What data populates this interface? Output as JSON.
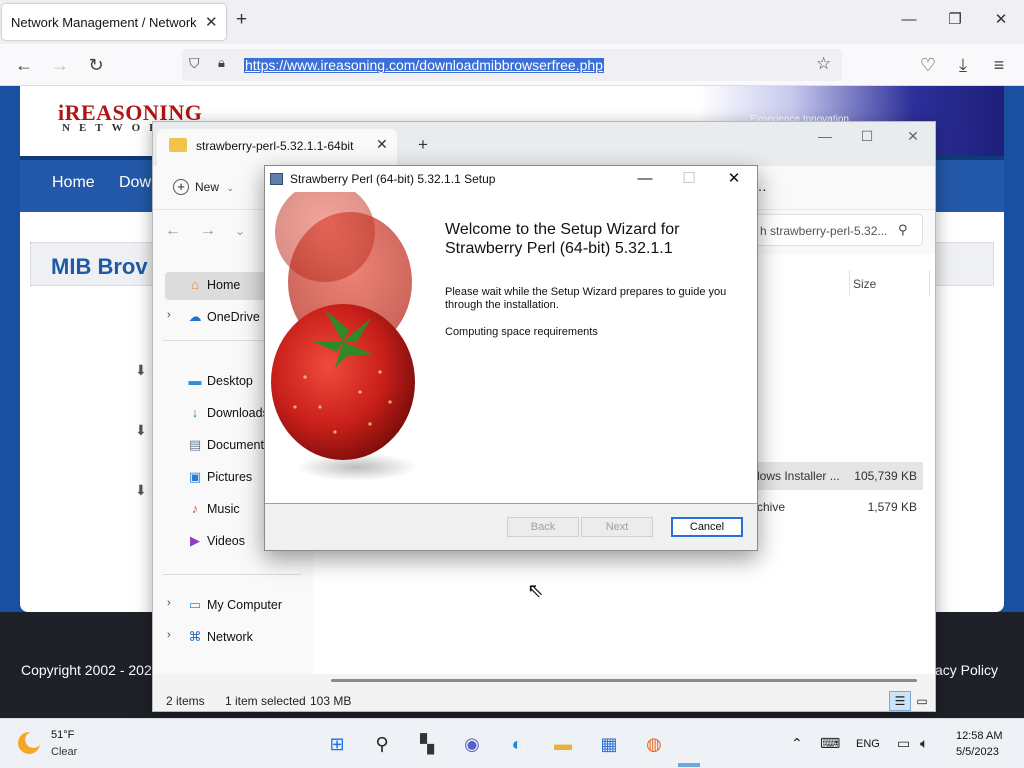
{
  "browser": {
    "tab_title": "Network Management / Network M",
    "url": "https://www.ireasoning.com/downloadmibbrowserfree.php"
  },
  "website": {
    "logo": "iREASONING",
    "logo_sub": "NETWOR",
    "banner_text": "Experience Innovation",
    "menu": [
      "Home",
      "Dow"
    ],
    "page_title": "MIB Brov",
    "copyright": "Copyright 2002 - 202",
    "privacy": "vacy Policy"
  },
  "explorer": {
    "tab_label": "strawberry-perl-5.32.1.1-64bit",
    "new_label": "New",
    "search_placeholder": "h strawberry-perl-5.32...",
    "column_size": "Size",
    "sidebar": [
      {
        "label": "Home",
        "icon": "home-icon"
      },
      {
        "label": "OneDrive",
        "icon": "cloud-icon"
      },
      {
        "label": "Desktop",
        "icon": "desktop-icon"
      },
      {
        "label": "Downloads",
        "icon": "download-icon"
      },
      {
        "label": "Documents",
        "icon": "document-icon"
      },
      {
        "label": "Pictures",
        "icon": "pictures-icon"
      },
      {
        "label": "Music",
        "icon": "music-icon"
      },
      {
        "label": "Videos",
        "icon": "videos-icon"
      },
      {
        "label": "My Computer",
        "icon": "computer-icon"
      },
      {
        "label": "Network",
        "icon": "network-icon"
      }
    ],
    "files": [
      {
        "type": "dows Installer ...",
        "size": "105,739 KB"
      },
      {
        "type": "rchive",
        "size": "1,579 KB"
      }
    ],
    "status": {
      "items": "2 items",
      "selected": "1 item selected",
      "size": "103 MB"
    }
  },
  "setup": {
    "title": "Strawberry Perl (64-bit) 5.32.1.1 Setup",
    "welcome": "Welcome to the Setup Wizard for Strawberry Perl (64-bit) 5.32.1.1",
    "wait_text": "Please wait while the Setup Wizard prepares to guide you through the installation.",
    "computing": "Computing space requirements",
    "buttons": {
      "back": "Back",
      "next": "Next",
      "cancel": "Cancel"
    }
  },
  "taskbar": {
    "weather_temp": "51°F",
    "weather_desc": "Clear",
    "language": "ENG",
    "time": "12:58 AM",
    "date": "5/5/2023"
  }
}
